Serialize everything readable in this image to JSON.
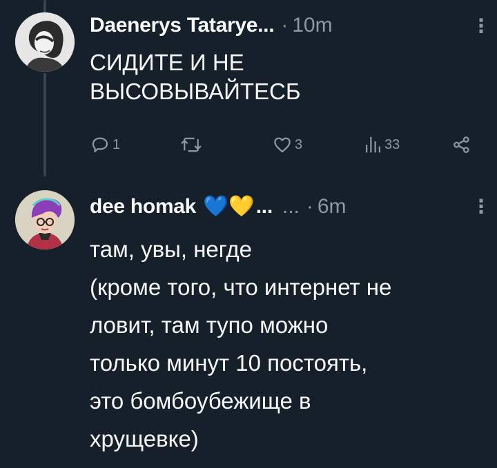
{
  "tweets": [
    {
      "author_name": "Daenerys Tatarye...",
      "separator": "·",
      "time": "10m",
      "text": "СИДИТЕ И НЕ\nВЫСОВЫВАЙТЕСБ",
      "counts": {
        "replies": "1",
        "retweets": "",
        "likes": "3",
        "views": "33"
      },
      "icons": [
        "reply-icon",
        "retweet-icon",
        "like-icon",
        "views-icon",
        "share-icon"
      ]
    },
    {
      "author_name": "dee homak",
      "emoji": "💙💛",
      "name_ellipsis": "...",
      "handle_ellipsis": "...",
      "separator": "·",
      "time": "6m",
      "text": "там, увы, негде\n(кроме того, что интернет не\nловит, там тупо можно\nтолько минут 10 постоять,\nэто бомбоубежище в\nхрущевке)"
    }
  ],
  "more_icon": "⋮",
  "colors": {
    "background": "#15202b",
    "text": "#f7f9f9",
    "secondary": "#8b98a5",
    "thread_line": "#38444d"
  }
}
